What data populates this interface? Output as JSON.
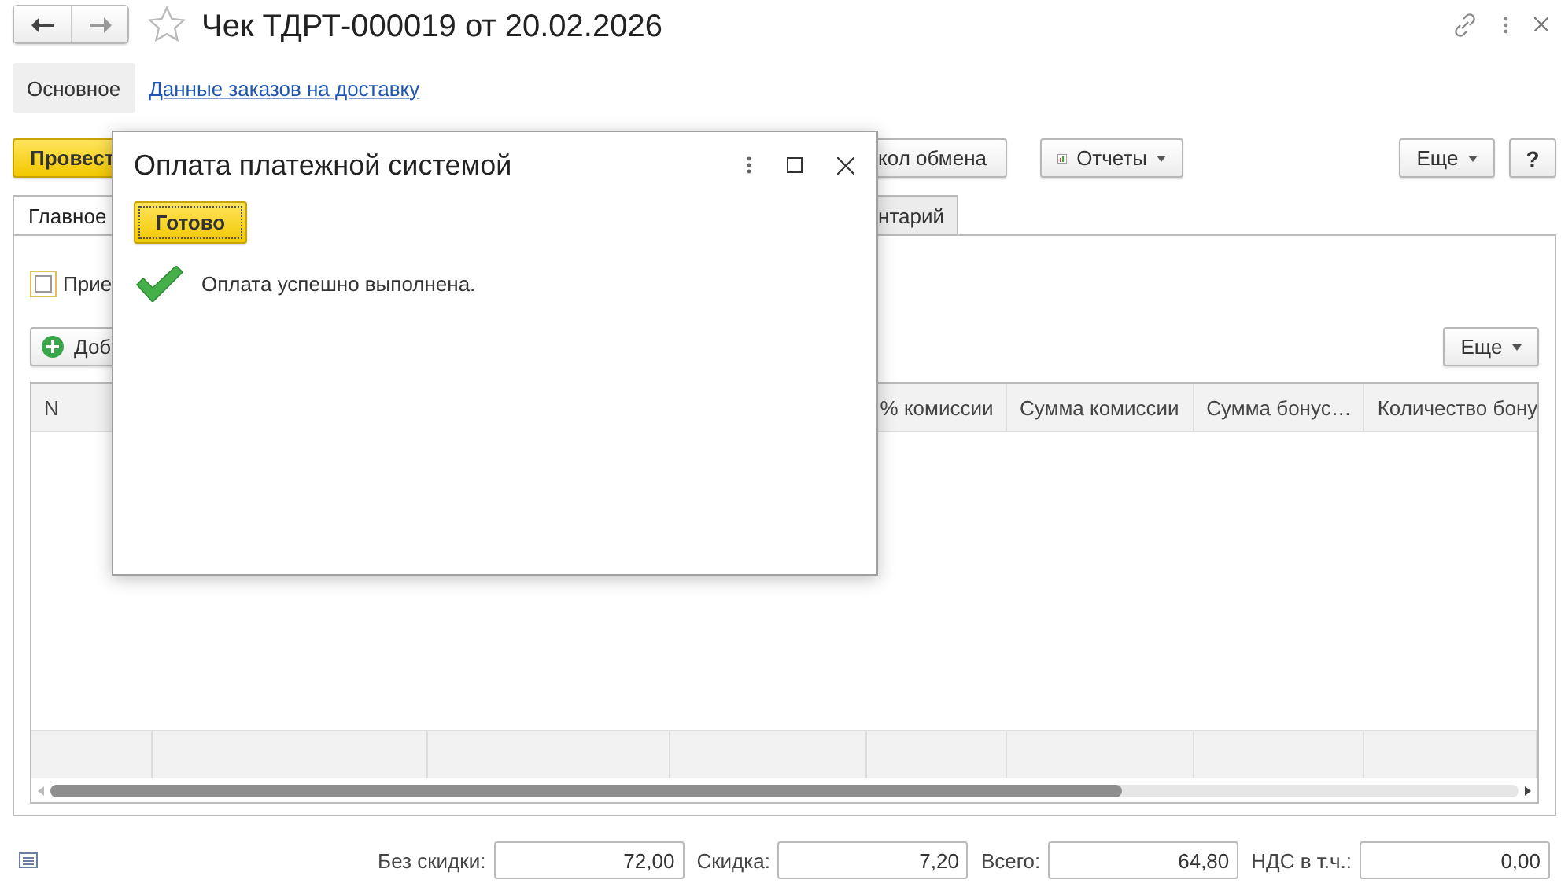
{
  "window": {
    "title": "Чек ТДРТ-000019 от 20.02.2026"
  },
  "nav_tabs": [
    {
      "label": "Основное",
      "selected": true
    },
    {
      "label": "Данные заказов на доставку",
      "selected": false
    }
  ],
  "toolbar": [
    {
      "kind": "primary",
      "label": "Провест"
    },
    {
      "kind": "partial",
      "label": "кол обмена"
    },
    {
      "kind": "reports",
      "label": "Отчеты"
    },
    {
      "kind": "more",
      "label": "Еще"
    },
    {
      "kind": "help",
      "label": "?"
    }
  ],
  "tabs": [
    {
      "label": "Главное",
      "selected": true
    },
    {
      "label": "нтарий",
      "selected": false
    }
  ],
  "checkbox": {
    "label": "Прие",
    "checked": false
  },
  "table_toolbar": {
    "add_label": "Доб",
    "more_label": "Еще"
  },
  "table": {
    "columns": [
      {
        "label": "N"
      },
      {
        "label": "% комиссии"
      },
      {
        "label": "Сумма комиссии"
      },
      {
        "label": "Сумма бонус…"
      },
      {
        "label": "Количество бону"
      }
    ]
  },
  "totals": [
    {
      "label": "Без скидки:",
      "value": "72,00"
    },
    {
      "label": "Скидка:",
      "value": "7,20"
    },
    {
      "label": "Всего:",
      "value": "64,80"
    },
    {
      "label": "НДС в т.ч.:",
      "value": "0,00"
    }
  ],
  "dialog": {
    "title": "Оплата платежной системой",
    "button": "Готово",
    "message": "Оплата успешно выполнена."
  }
}
